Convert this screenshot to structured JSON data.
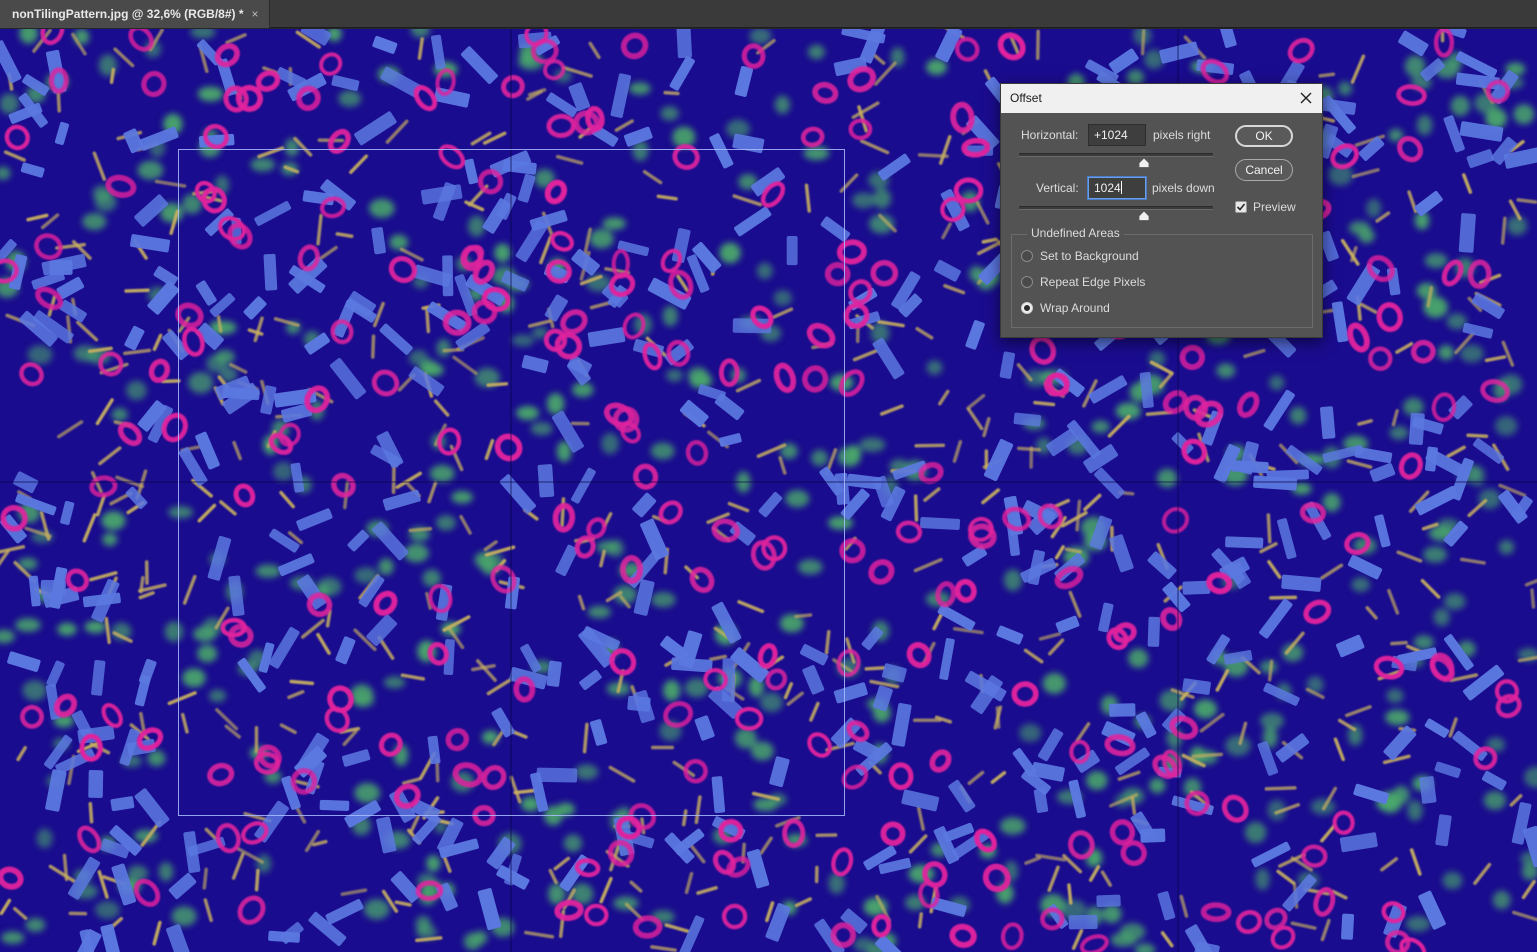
{
  "document_tab": {
    "title": "nonTilingPattern.jpg @ 32,6% (RGB/8#) *",
    "close_glyph": "×"
  },
  "offset_dialog": {
    "title": "Offset",
    "horizontal": {
      "label": "Horizontal:",
      "value": "+1024",
      "unit": "pixels right"
    },
    "vertical": {
      "label": "Vertical:",
      "value": "1024",
      "unit": "pixels down"
    },
    "buttons": {
      "ok": "OK",
      "cancel": "Cancel"
    },
    "preview": {
      "label": "Preview",
      "checked": true
    },
    "undefined_areas": {
      "legend": "Undefined Areas",
      "options": [
        {
          "label": "Set to Background",
          "selected": false
        },
        {
          "label": "Repeat Edge Pixels",
          "selected": false
        },
        {
          "label": "Wrap Around",
          "selected": true
        }
      ]
    }
  },
  "colors": {
    "canvas_bg": "#1a0c8e",
    "blue_shape": "#5b78e0",
    "magenta_ring": "#e0229e",
    "green_blob": "#4aa86a",
    "gold_stick": "#c8b060",
    "dialog_bg": "#535353",
    "accent": "#4a7cc8"
  }
}
